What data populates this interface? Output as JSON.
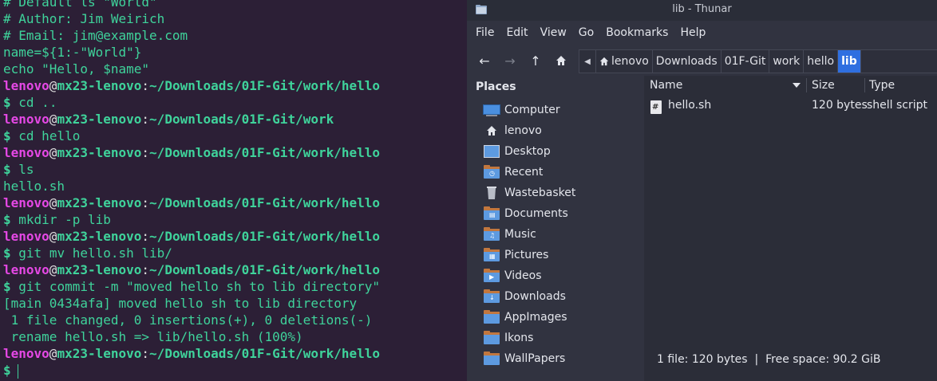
{
  "terminal": {
    "lines": [
      {
        "type": "text",
        "text": "# Default ls \"World\""
      },
      {
        "type": "text",
        "text": "# Author: Jim Weirich"
      },
      {
        "type": "text",
        "text": "# Email: jim@example.com"
      },
      {
        "type": "text",
        "text": "name=${1:-\"World\"}"
      },
      {
        "type": "text",
        "text": "echo \"Hello, $name\""
      },
      {
        "type": "prompt",
        "user": "lenovo",
        "host": "mx23-lenovo",
        "path": "~/Downloads/01F-Git/work/hello"
      },
      {
        "type": "cmd",
        "text": "cd .."
      },
      {
        "type": "prompt",
        "user": "lenovo",
        "host": "mx23-lenovo",
        "path": "~/Downloads/01F-Git/work"
      },
      {
        "type": "cmd",
        "text": "cd hello"
      },
      {
        "type": "prompt",
        "user": "lenovo",
        "host": "mx23-lenovo",
        "path": "~/Downloads/01F-Git/work/hello"
      },
      {
        "type": "cmd",
        "text": "ls"
      },
      {
        "type": "text",
        "text": "hello.sh"
      },
      {
        "type": "prompt",
        "user": "lenovo",
        "host": "mx23-lenovo",
        "path": "~/Downloads/01F-Git/work/hello"
      },
      {
        "type": "cmd",
        "text": "mkdir -p lib"
      },
      {
        "type": "prompt",
        "user": "lenovo",
        "host": "mx23-lenovo",
        "path": "~/Downloads/01F-Git/work/hello"
      },
      {
        "type": "cmd",
        "text": "git mv hello.sh lib/"
      },
      {
        "type": "prompt",
        "user": "lenovo",
        "host": "mx23-lenovo",
        "path": "~/Downloads/01F-Git/work/hello"
      },
      {
        "type": "cmd",
        "text": "git commit -m \"moved hello sh to lib directory\""
      },
      {
        "type": "text",
        "text": "[main 0434afa] moved hello sh to lib directory"
      },
      {
        "type": "text",
        "text": " 1 file changed, 0 insertions(+), 0 deletions(-)"
      },
      {
        "type": "text",
        "text": " rename hello.sh => lib/hello.sh (100%)"
      },
      {
        "type": "prompt",
        "user": "lenovo",
        "host": "mx23-lenovo",
        "path": "~/Downloads/01F-Git/work/hello"
      },
      {
        "type": "input",
        "text": ""
      }
    ],
    "prompt_symbol": "$",
    "at": "@",
    "colon": ":"
  },
  "thunar": {
    "title": "lib - Thunar",
    "menu": [
      "File",
      "Edit",
      "View",
      "Go",
      "Bookmarks",
      "Help"
    ],
    "path": [
      "lenovo",
      "Downloads",
      "01F-Git",
      "work",
      "hello",
      "lib"
    ],
    "active_crumb": "lib",
    "sidebar_title": "Places",
    "places": [
      {
        "label": "Computer",
        "icon": "computer-icon"
      },
      {
        "label": "lenovo",
        "icon": "home-icon"
      },
      {
        "label": "Desktop",
        "icon": "desktop-icon"
      },
      {
        "label": "Recent",
        "icon": "recent-folder-icon"
      },
      {
        "label": "Wastebasket",
        "icon": "trash-icon"
      },
      {
        "label": "Documents",
        "icon": "documents-folder-icon"
      },
      {
        "label": "Music",
        "icon": "music-folder-icon"
      },
      {
        "label": "Pictures",
        "icon": "pictures-folder-icon"
      },
      {
        "label": "Videos",
        "icon": "videos-folder-icon"
      },
      {
        "label": "Downloads",
        "icon": "downloads-folder-icon"
      },
      {
        "label": "AppImages",
        "icon": "folder-icon"
      },
      {
        "label": "Ikons",
        "icon": "folder-icon"
      },
      {
        "label": "WallPapers",
        "icon": "folder-icon"
      }
    ],
    "columns": {
      "name": "Name",
      "size": "Size",
      "type": "Type"
    },
    "files": [
      {
        "name": "hello.sh",
        "size": "120 bytes",
        "type": "shell script"
      }
    ],
    "status": "1 file: 120 bytes  |  Free space: 90.2 GiB",
    "colors": {
      "accent": "#2f6fe0",
      "terminal_green": "#3fd39b",
      "terminal_user": "#e548e5"
    }
  }
}
